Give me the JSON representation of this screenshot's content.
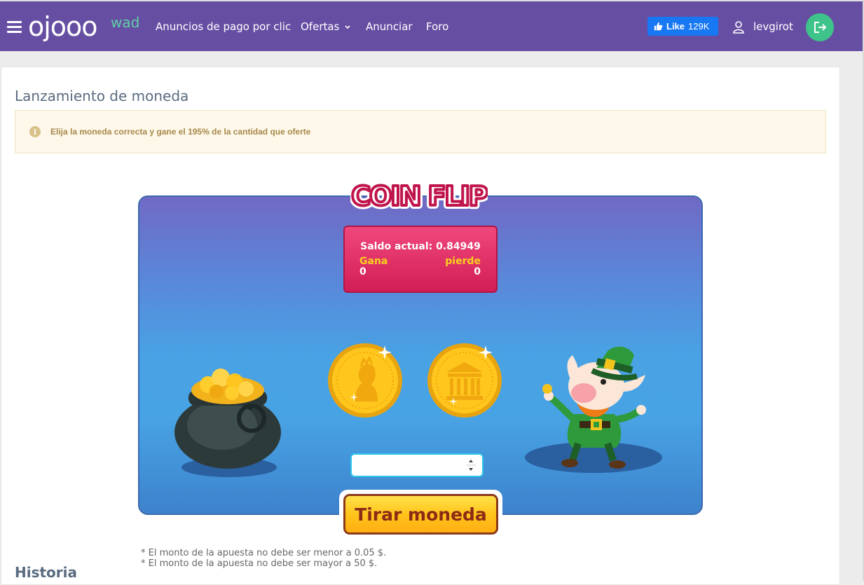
{
  "header": {
    "logo_main": "ojooo",
    "logo_sup": "wad",
    "nav": [
      {
        "label": "Anuncios de pago por clic"
      },
      {
        "label": "Ofertas"
      },
      {
        "label": "Anunciar"
      },
      {
        "label": "Foro"
      }
    ],
    "fb_like": {
      "label": "Like",
      "count": "129K"
    },
    "username": "levgirot",
    "colors": {
      "bar": "#664fa3",
      "logout": "#3ec48a",
      "fb": "#1877f2"
    }
  },
  "page": {
    "title": "Lanzamiento de moneda",
    "alert": "Elija la moneda correcta y gane el 195% de la cantidad que oferte"
  },
  "game": {
    "logo_text": "COIN FLIP",
    "balance_label": "Saldo actual: 0.84949",
    "win_label": "Gana",
    "win_value": "0",
    "lose_label": "pierde",
    "lose_value": "0",
    "bet_value": "",
    "flip_button": "Tirar moneda",
    "coins": [
      "queen-head-coin",
      "temple-coin"
    ]
  },
  "notes": [
    "* El monto de la apuesta no debe ser menor a 0.05 $.",
    "* El monto de la apuesta no debe ser mayor a 50 $."
  ],
  "history_title": "Historia"
}
